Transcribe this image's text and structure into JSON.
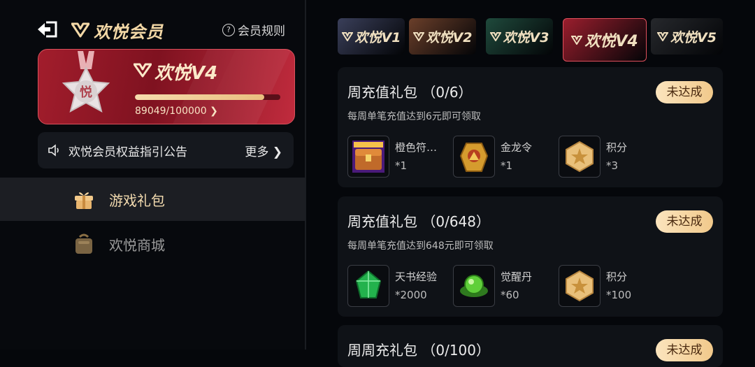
{
  "header": {
    "title": "欢悦会员",
    "rules_label": "会员规则"
  },
  "member_card": {
    "level": "欢悦V4",
    "score_text": "89049/100000",
    "progress": 0.89
  },
  "notice": {
    "text": "欢悦会员权益指引公告",
    "more_label": "更多"
  },
  "nav": [
    {
      "label": "游戏礼包",
      "active": true
    },
    {
      "label": "欢悦商城",
      "active": false
    }
  ],
  "tabs": [
    {
      "label": "欢悦V1",
      "color": "#3a3f5a"
    },
    {
      "label": "欢悦V2",
      "color": "#6b3f2a"
    },
    {
      "label": "欢悦V3",
      "color": "#1f4a3c"
    },
    {
      "label": "欢悦V4",
      "color": "#9a1e2d",
      "selected": true
    },
    {
      "label": "欢悦V5",
      "color": "#26282c"
    }
  ],
  "packs": [
    {
      "title": "周充值礼包 （0/6）",
      "desc": "每周单笔充值达到6元即可领取",
      "status": "未达成",
      "rewards": [
        {
          "name": "橙色符…",
          "qty": "*1",
          "icon": "chest-icon"
        },
        {
          "name": "金龙令",
          "qty": "*1",
          "icon": "gold-token-icon"
        },
        {
          "name": "积分",
          "qty": "*3",
          "icon": "points-icon"
        }
      ]
    },
    {
      "title": "周充值礼包 （0/648）",
      "desc": "每周单笔充值达到648元即可领取",
      "status": "未达成",
      "rewards": [
        {
          "name": "天书经验",
          "qty": "*2000",
          "icon": "green-gem-icon"
        },
        {
          "name": "觉醒丹",
          "qty": "*60",
          "icon": "green-orb-icon"
        },
        {
          "name": "积分",
          "qty": "*100",
          "icon": "points-icon"
        }
      ]
    },
    {
      "title": "周周充礼包 （0/100）",
      "status": "未达成"
    }
  ],
  "colors": {
    "accent_gold": "#f3d8a6",
    "card_red": "#a21d2c",
    "status_bg": "#f6d7a3"
  }
}
